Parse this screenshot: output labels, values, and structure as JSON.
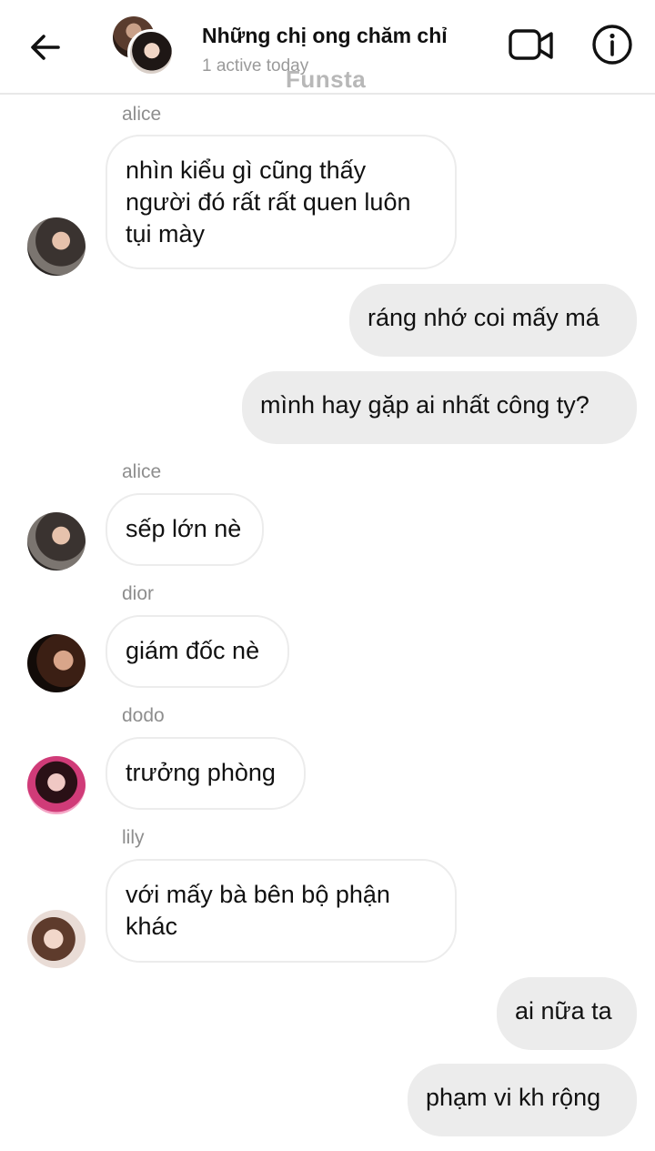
{
  "header": {
    "title": "Những chị ong chăm chỉ",
    "status": "1 active today",
    "watermark": "Funsta",
    "back_icon": "arrow-left-icon",
    "video_icon": "video-camera-icon",
    "info_icon": "info-icon"
  },
  "messages": [
    {
      "sender": "alice",
      "text": "nhìn kiểu gì cũng thấy người đó rất rất quen luôn tụi mày",
      "direction": "incoming"
    },
    {
      "text": "ráng nhớ coi mấy má",
      "direction": "outgoing"
    },
    {
      "text": "mình hay gặp ai nhất công ty?",
      "direction": "outgoing"
    },
    {
      "sender": "alice",
      "text": "sếp lớn nè",
      "direction": "incoming"
    },
    {
      "sender": "dior",
      "text": "giám đốc nè",
      "direction": "incoming"
    },
    {
      "sender": "dodo",
      "text": "trưởng phòng",
      "direction": "incoming"
    },
    {
      "sender": "lily",
      "text": "với mấy bà bên bộ phận khác",
      "direction": "incoming"
    },
    {
      "text": "ai nữa ta",
      "direction": "outgoing"
    },
    {
      "text": "phạm vi kh rộng",
      "direction": "outgoing"
    }
  ],
  "colors": {
    "incoming_bubble_bg": "#ffffff",
    "incoming_bubble_border": "#ececec",
    "outgoing_bubble_bg": "#ececec",
    "sender_text": "#8e8e8e",
    "secondary_text": "#9a9a9a"
  }
}
